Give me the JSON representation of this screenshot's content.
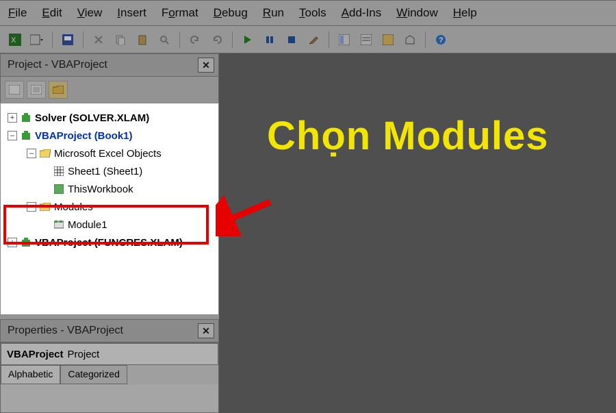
{
  "menu": {
    "file": "File",
    "edit": "Edit",
    "view": "View",
    "insert": "Insert",
    "format": "Format",
    "debug": "Debug",
    "run": "Run",
    "tools": "Tools",
    "addins": "Add-Ins",
    "window": "Window",
    "help": "Help"
  },
  "project_panel": {
    "title": "Project - VBAProject"
  },
  "tree": {
    "solver": "Solver (SOLVER.XLAM)",
    "vbaproject_book1": "VBAProject (Book1)",
    "ms_excel_objects": "Microsoft Excel Objects",
    "sheet1": "Sheet1 (Sheet1)",
    "thisworkbook": "ThisWorkbook",
    "modules": "Modules",
    "module1": "Module1",
    "vbaproject_funcres": "VBAProject (FUNCRES.XLAM)"
  },
  "properties_panel": {
    "title": "Properties - VBAProject",
    "object_line": "VBAProject Project",
    "tab_alpha": "Alphabetic",
    "tab_cat": "Categorized"
  },
  "annotation": {
    "text": "Chọn Modules"
  }
}
